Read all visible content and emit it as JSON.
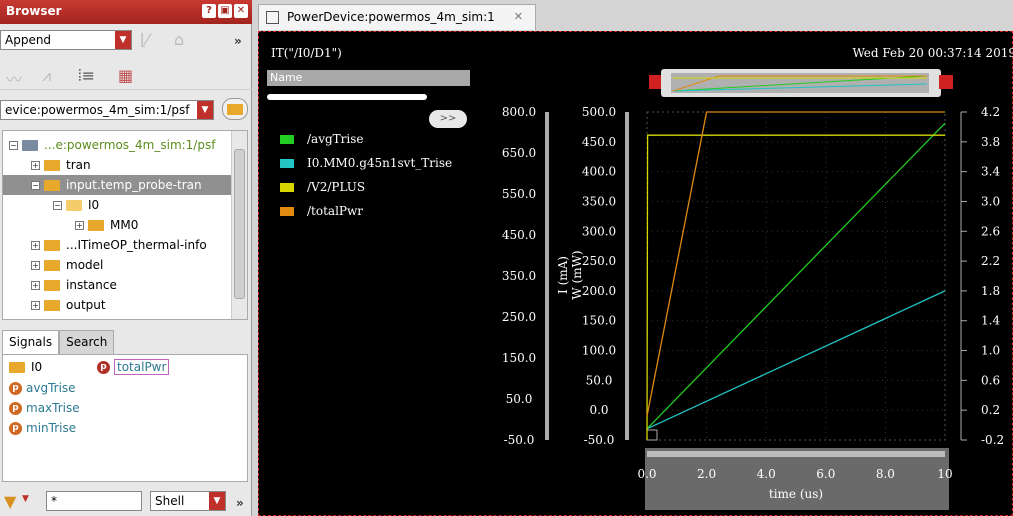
{
  "browser": {
    "title": "Browser",
    "append_label": "Append",
    "path_value": "evice:powermos_4m_sim:1/psf",
    "tree": [
      {
        "label": "...e:powermos_4m_sim:1/psf",
        "indent": 6,
        "expander": "−",
        "kind": "root"
      },
      {
        "label": "tran",
        "indent": 28,
        "expander": "+",
        "kind": "folder"
      },
      {
        "label": "input.temp_probe-tran",
        "indent": 28,
        "expander": "−",
        "kind": "folder",
        "selected": true
      },
      {
        "label": "I0",
        "indent": 50,
        "expander": "−",
        "kind": "open"
      },
      {
        "label": "MM0",
        "indent": 72,
        "expander": "+",
        "kind": "folder"
      },
      {
        "label": "...ITimeOP_thermal-info",
        "indent": 28,
        "expander": "+",
        "kind": "folder"
      },
      {
        "label": "model",
        "indent": 28,
        "expander": "+",
        "kind": "folder"
      },
      {
        "label": "instance",
        "indent": 28,
        "expander": "+",
        "kind": "folder"
      },
      {
        "label": "output",
        "indent": 28,
        "expander": "+",
        "kind": "folder"
      }
    ],
    "tabs": [
      "Signals",
      "Search"
    ],
    "signals": {
      "folder": "I0",
      "boxed": "totalPwr",
      "items": [
        "avgTrise",
        "maxTrise",
        "minTrise"
      ]
    },
    "filter_value": "*",
    "shell_label": "Shell"
  },
  "window": {
    "tab_title": "PowerDevice:powermos_4m_sim:1",
    "plot_title": "IT(\"/I0/D1\")",
    "timestamp": "Wed Feb 20 00:37:14 2019",
    "name_header": "Name",
    "expand_label": ">>"
  },
  "chart_data": {
    "type": "line",
    "xlabel": "time (us)",
    "x_ticks": [
      "0.0",
      "2.0",
      "4.0",
      "6.0",
      "8.0",
      "10"
    ],
    "xlim": [
      0,
      10
    ],
    "axis_I": {
      "label": "I (mA)",
      "ticks": [
        "800.0",
        "650.0",
        "550.0",
        "450.0",
        "350.0",
        "250.0",
        "150.0",
        "50.0",
        "-50.0"
      ]
    },
    "axis_W": {
      "label": "W (mW)",
      "ticks": [
        "500.0",
        "450.0",
        "400.0",
        "350.0",
        "300.0",
        "250.0",
        "200.0",
        "150.0",
        "100.0",
        "50.0",
        "0.0",
        "-50.0"
      ],
      "ylim": [
        -50,
        500
      ]
    },
    "axis_right": {
      "ticks": [
        "4.2",
        "3.8",
        "3.4",
        "3.0",
        "2.6",
        "2.2",
        "1.8",
        "1.4",
        "1.0",
        "0.6",
        "0.2",
        "-0.2"
      ],
      "ylim": [
        -0.2,
        4.2
      ]
    },
    "series": [
      {
        "name": "/avgTrise",
        "color": "#22cc22",
        "axis": "right",
        "x": [
          0,
          10
        ],
        "y": [
          -0.05,
          4.05
        ]
      },
      {
        "name": "I0.MM0.g45n1svt_Trise",
        "color": "#22c4c4",
        "axis": "right",
        "x": [
          0,
          10
        ],
        "y": [
          -0.05,
          1.8
        ]
      },
      {
        "name": "/V2/PLUS",
        "color": "#d8d800",
        "axis": "I",
        "x": [
          0,
          0.02,
          10
        ],
        "y": [
          -50,
          740,
          740
        ]
      },
      {
        "name": "/totalPwr",
        "color": "#e08a10",
        "axis": "W",
        "x": [
          0,
          2,
          10
        ],
        "y": [
          -10,
          500,
          500
        ]
      }
    ]
  }
}
